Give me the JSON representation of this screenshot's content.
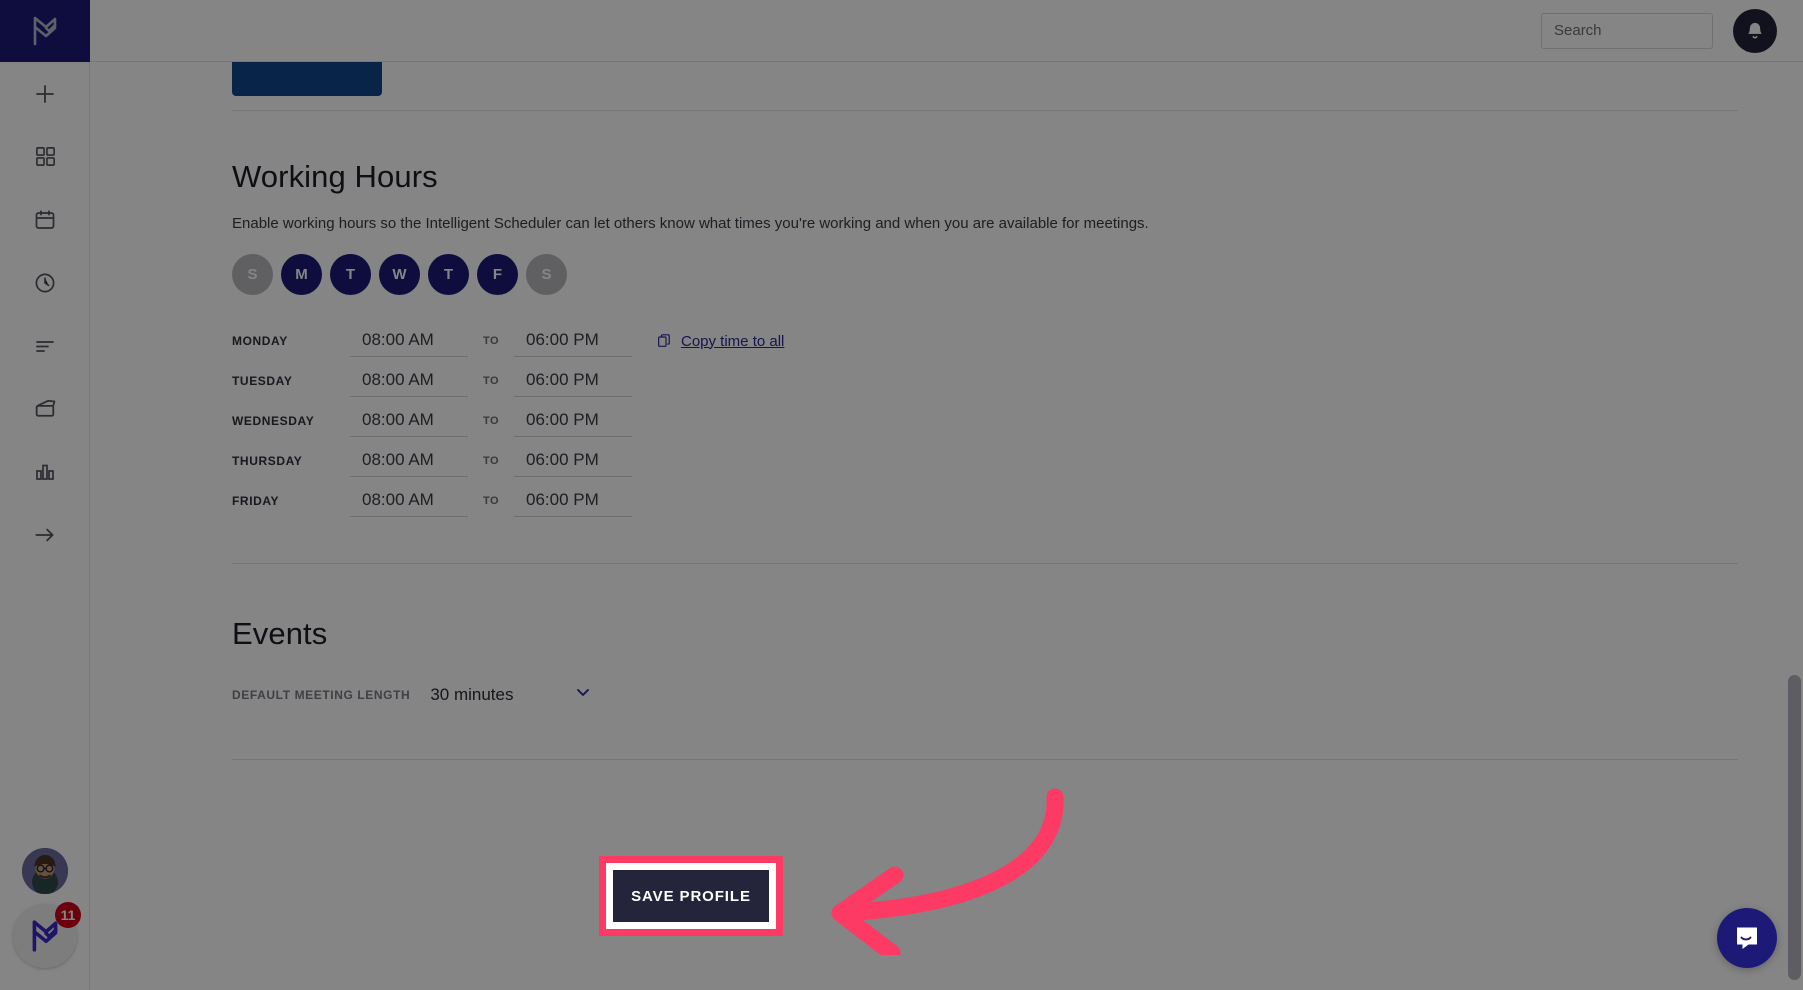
{
  "app": {
    "logo_icon": "meetingbird-logo-icon",
    "brand_color": "#1d1a77",
    "accent_highlight_color": "#fc3a63"
  },
  "rail": {
    "items": [
      {
        "icon": "plus-icon",
        "name": "add"
      },
      {
        "icon": "grid-icon",
        "name": "apps"
      },
      {
        "icon": "calendar-icon",
        "name": "calendar"
      },
      {
        "icon": "clock-icon",
        "name": "scheduler"
      },
      {
        "icon": "list-icon",
        "name": "tasks"
      },
      {
        "icon": "inbox-icon",
        "name": "inbox"
      },
      {
        "icon": "chart-icon",
        "name": "analytics"
      },
      {
        "icon": "arrow-right-icon",
        "name": "expand"
      }
    ],
    "avatar": {
      "icon": "user-avatar",
      "name": "account-avatar"
    },
    "help": {
      "icon": "meetingbird-logo-icon",
      "badge_count": "11"
    }
  },
  "topbar": {
    "search": {
      "placeholder": "Search",
      "value": "",
      "icon": "search-icon"
    },
    "notifications": {
      "icon": "bell-icon"
    }
  },
  "working_hours": {
    "title": "Working Hours",
    "description": "Enable working hours so the Intelligent Scheduler can let others know what times you're working and when you are available for meetings.",
    "days": [
      {
        "label": "S",
        "full": "sunday",
        "enabled": false
      },
      {
        "label": "M",
        "full": "monday",
        "enabled": true
      },
      {
        "label": "T",
        "full": "tuesday",
        "enabled": true
      },
      {
        "label": "W",
        "full": "wednesday",
        "enabled": true
      },
      {
        "label": "T",
        "full": "thursday",
        "enabled": true
      },
      {
        "label": "F",
        "full": "friday",
        "enabled": true
      },
      {
        "label": "S",
        "full": "saturday",
        "enabled": false
      }
    ],
    "to_label": "TO",
    "copy_link": {
      "label": "Copy time to all",
      "icon": "copy-icon"
    },
    "rows": [
      {
        "day": "MONDAY",
        "start": "08:00 AM",
        "end": "06:00 PM",
        "has_copy_link": true
      },
      {
        "day": "TUESDAY",
        "start": "08:00 AM",
        "end": "06:00 PM",
        "has_copy_link": false
      },
      {
        "day": "WEDNESDAY",
        "start": "08:00 AM",
        "end": "06:00 PM",
        "has_copy_link": false
      },
      {
        "day": "THURSDAY",
        "start": "08:00 AM",
        "end": "06:00 PM",
        "has_copy_link": false
      },
      {
        "day": "FRIDAY",
        "start": "08:00 AM",
        "end": "06:00 PM",
        "has_copy_link": false
      }
    ]
  },
  "events": {
    "title": "Events",
    "meeting_length_label": "DEFAULT MEETING LENGTH",
    "meeting_length_value": "30 minutes",
    "chevron_icon": "chevron-down-icon"
  },
  "footer": {
    "save_label": "SAVE PROFILE"
  },
  "annotations": {
    "arrow_icon": "curved-arrow-left-icon",
    "highlight_target": "save-profile-button"
  },
  "intercom": {
    "icon": "chat-bubble-icon"
  }
}
